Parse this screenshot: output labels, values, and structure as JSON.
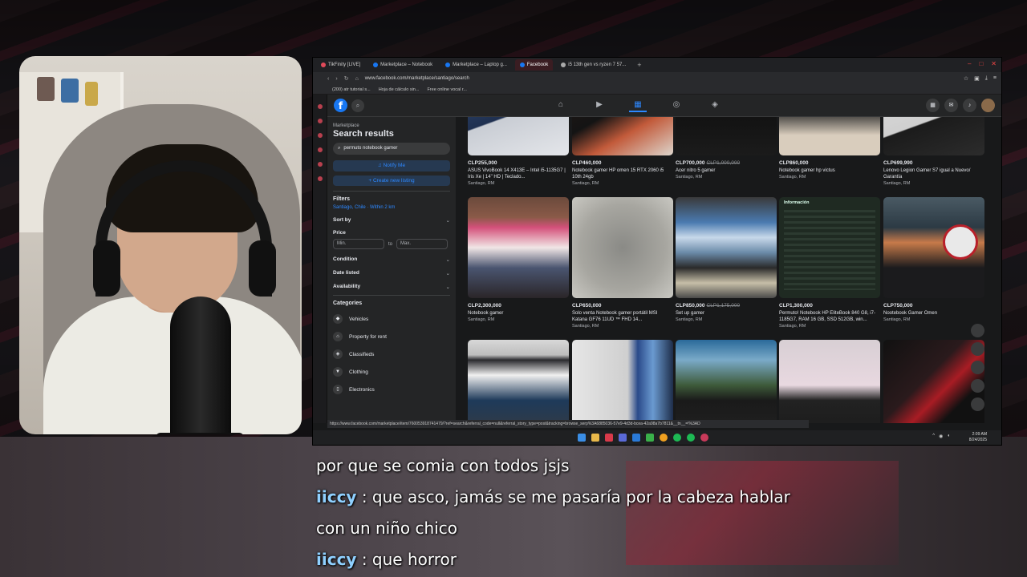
{
  "browser": {
    "tabs": [
      {
        "label": "TikFinity [LIVE]",
        "color": "#e04a5a",
        "active": false
      },
      {
        "label": "Marketplace – Notebook",
        "color": "#1877f2",
        "active": false
      },
      {
        "label": "Marketplace – Laptop g...",
        "color": "#1877f2",
        "active": false
      },
      {
        "label": "Facebook",
        "color": "#1877f2",
        "active": true
      },
      {
        "label": "i5 13th gen vs ryzen 7 57...",
        "color": "#aaaaaa",
        "active": false
      }
    ],
    "url": "www.facebook.com/marketplace/santiago/search",
    "bookmarks": [
      "(200) atr tutorial s...",
      "Hoja de cálculo sin...",
      "Free online vocal r..."
    ],
    "status_url": "https://www.facebook.com/marketplace/item/760053918741479/?ref=search&referral_code=null&referral_story_type=post&tracking=browse_serp%3A6885036-57e9-4d3d-bcea-42a98a7b7811&__tn__=!%3AD"
  },
  "sidebar": {
    "breadcrumb": "Marketplace",
    "title": "Search results",
    "search_value": "permuto notebook gamer",
    "notify_label": "Notify Me",
    "create_label": "Create new listing",
    "filters_label": "Filters",
    "location": "Santiago, Chile · Within 2 km",
    "sort_label": "Sort by",
    "price_label": "Price",
    "min_placeholder": "Min.",
    "to_label": "to",
    "max_placeholder": "Max.",
    "condition_label": "Condition",
    "date_label": "Date listed",
    "availability_label": "Availability",
    "categories_label": "Categories",
    "categories": [
      {
        "label": "Vehicles",
        "icon": "car-icon"
      },
      {
        "label": "Property for rent",
        "icon": "house-icon"
      },
      {
        "label": "Classifieds",
        "icon": "tag-icon"
      },
      {
        "label": "Clothing",
        "icon": "shirt-icon"
      },
      {
        "label": "Electronics",
        "icon": "phone-icon"
      }
    ]
  },
  "listings": [
    {
      "price": "CLP255,000",
      "old_price": "",
      "title": "ASUS VivoBook 14 X413E – Intel i5-1135G7 | Iris Xe | 14\" HD | Teclado...",
      "location": "Santiago, RM"
    },
    {
      "price": "CLP460,000",
      "old_price": "",
      "title": "Notebook gamer HP omen 15 RTX 2060 i5 10th 24gb",
      "location": "Santiago, RM"
    },
    {
      "price": "CLP700,000",
      "old_price": "CLP1,000,000",
      "title": "Acer nitro 5 gamer",
      "location": "Santiago, RM"
    },
    {
      "price": "CLP860,000",
      "old_price": "",
      "title": "Notebook gamer hp victus",
      "location": "Santiago, RM"
    },
    {
      "price": "CLP699,990",
      "old_price": "",
      "title": "Lenovo Legion Gamer S7 igual a Nuevo/ Garantía",
      "location": "Santiago, RM"
    },
    {
      "price": "CLP2,300,000",
      "old_price": "",
      "title": "Notebook gamer",
      "location": "Santiago, RM"
    },
    {
      "price": "CLP650,000",
      "old_price": "",
      "title": "Solo venta Notebook gamer portátil MSI Katana GF76 11UD ™ FHD 14...",
      "location": "Santiago, RM"
    },
    {
      "price": "CLP850,000",
      "old_price": "CLP1,175,000",
      "title": "Set up gamer",
      "location": "Santiago, RM"
    },
    {
      "price": "CLP1,300,000",
      "old_price": "",
      "title": "Permuto! Notebook HP EliteBook 840 G8, i7-1185G7, RAM 16 GB, SSD 512GB, win...",
      "location": "Santiago, RM"
    },
    {
      "price": "CLP750,000",
      "old_price": "",
      "title": "Nootebook Gamer Omen",
      "location": "Santiago, RM"
    }
  ],
  "listing_image_section": "Información",
  "clock": {
    "time": "2:09 AM",
    "date": "8/24/2025"
  },
  "captions": [
    {
      "user": "",
      "text": "por que se comia con todos jsjs"
    },
    {
      "user": "iiccy",
      "text": " : que asco, jamás se me pasaría por la cabeza hablar"
    },
    {
      "user": "",
      "text": "con un niño chico"
    },
    {
      "user": "iiccy",
      "text": " : que horror"
    }
  ]
}
